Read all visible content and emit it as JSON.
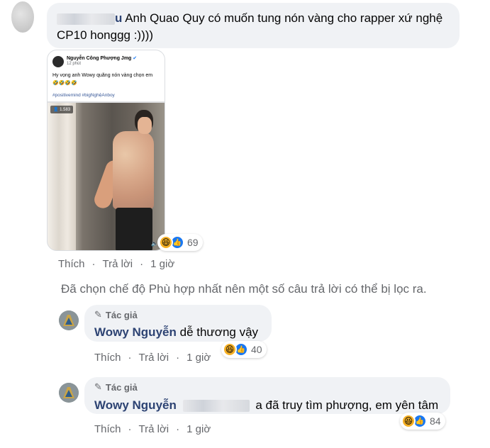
{
  "top_comment": {
    "text": "Anh Quao Quy có muốn tung nón vàng cho rapper xứ nghệ CP10 honggg :))))",
    "line1": "Anh Quao Quy có muốn tung nón vàng cho rapper xứ nghệ",
    "line2": "CP10 honggg :))))",
    "name_partial": "u",
    "image": {
      "poster_name": "Nguyễn Công Phượng Jmg",
      "time": "12 phút",
      "caption": "Hy vọng anh Wowy quăng nón vàng chọn em",
      "emojis": "🤣🤣🤣🤣",
      "hashtags": "#positivemind #bigNghệAnboy",
      "viewers": "1.583"
    },
    "reactions": {
      "count": "69",
      "icons": [
        "haha-icon",
        "like-icon"
      ]
    },
    "actions": {
      "like": "Thích",
      "reply": "Trả lời",
      "time": "1 giờ"
    }
  },
  "filter_note": "Đã chọn chế độ Phù hợp nhất nên một số câu trả lời có thể bị lọc ra.",
  "replies": [
    {
      "badge": "Tác giả",
      "author": "Wowy Nguyễn",
      "text": "dễ thương vậy",
      "reactions": {
        "count": "40",
        "icons": [
          "haha-icon",
          "like-icon"
        ]
      },
      "actions": {
        "like": "Thích",
        "reply": "Trả lời",
        "time": "1 giờ"
      }
    },
    {
      "badge": "Tác giả",
      "author": "Wowy Nguyễn",
      "text": "a đã truy tìm phượng, em yên tâm",
      "reactions": {
        "count": "84",
        "icons": [
          "haha-icon",
          "like-icon"
        ]
      },
      "actions": {
        "like": "Thích",
        "reply": "Trả lời",
        "time": "1 giờ"
      }
    }
  ],
  "colors": {
    "bubble": "#f0f2f5",
    "author": "#2d4373",
    "meta": "#65676b",
    "like_blue": "#1877f2",
    "haha_yellow": "#f7b125"
  }
}
